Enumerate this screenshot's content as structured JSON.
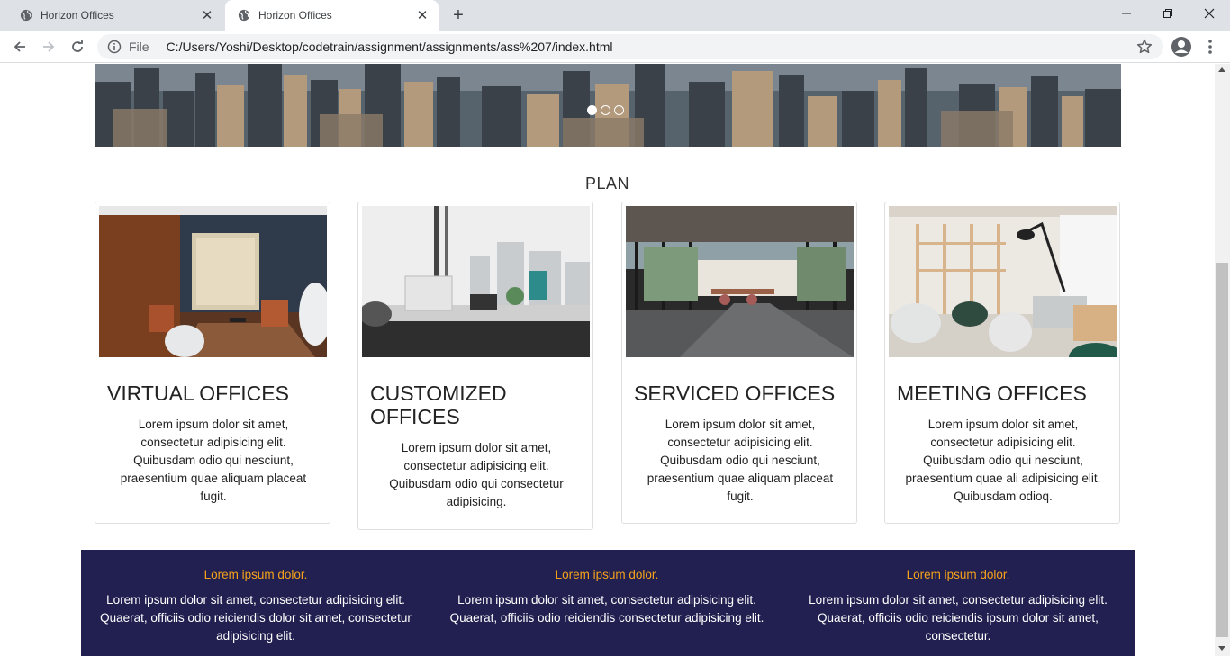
{
  "browser": {
    "tabs": [
      {
        "title": "Horizon Offices",
        "active": false
      },
      {
        "title": "Horizon Offices",
        "active": true
      }
    ],
    "omnibox": {
      "scheme": "File",
      "url": "C:/Users/Yoshi/Desktop/codetrain/assignment/assignments/ass%207/index.html"
    }
  },
  "page": {
    "carousel": {
      "slides": 3,
      "active_index": 0
    },
    "section_title": "PLAN",
    "cards": [
      {
        "title": "VIRTUAL OFFICES",
        "text": "Lorem ipsum dolor sit amet, consectetur adipisicing elit. Quibusdam odio qui nesciunt, praesentium quae aliquam placeat fugit."
      },
      {
        "title": "CUSTOMIZED OFFICES",
        "text": "Lorem ipsum dolor sit amet, consectetur adipisicing elit. Quibusdam odio qui consectetur adipisicing."
      },
      {
        "title": "SERVICED OFFICES",
        "text": "Lorem ipsum dolor sit amet, consectetur adipisicing elit. Quibusdam odio qui nesciunt, praesentium quae aliquam placeat fugit."
      },
      {
        "title": "MEETING OFFICES",
        "text": "Lorem ipsum dolor sit amet, consectetur adipisicing elit. Quibusdam odio qui nesciunt, praesentium quae ali adipisicing elit. Quibusdam odioq."
      }
    ],
    "footer_band": [
      {
        "heading": "Lorem ipsum dolor.",
        "text": "Lorem ipsum dolor sit amet, consectetur adipisicing elit. Quaerat, officiis odio reiciendis dolor sit amet, consectetur adipisicing elit."
      },
      {
        "heading": "Lorem ipsum dolor.",
        "text": "Lorem ipsum dolor sit amet, consectetur adipisicing elit. Quaerat, officiis odio reiciendis consectetur adipisicing elit."
      },
      {
        "heading": "Lorem ipsum dolor.",
        "text": "Lorem ipsum dolor sit amet, consectetur adipisicing elit. Quaerat, officiis odio reiciendis ipsum dolor sit amet, consectetur."
      }
    ]
  },
  "colors": {
    "band_background": "#222050",
    "band_heading": "#f5a21b",
    "tabstrip": "#dee1e6"
  }
}
